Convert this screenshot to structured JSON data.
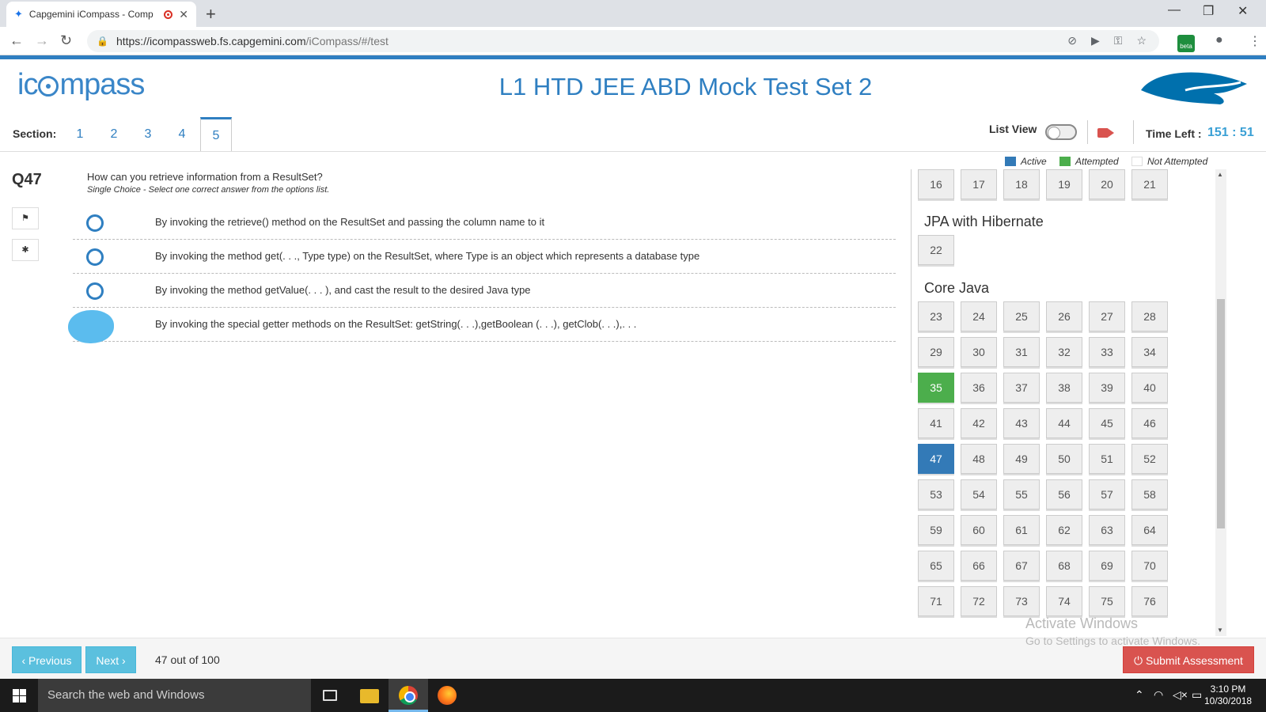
{
  "browser": {
    "tab_title": "Capgemini iCompass - Comp",
    "close_tab": "✕",
    "new_tab": "+",
    "window_controls": [
      "—",
      "❐",
      "✕"
    ],
    "nav": {
      "back": "←",
      "forward": "→",
      "reload": "↻"
    },
    "url_host": "https://icompassweb.fs.capgemini.com",
    "url_path": "/iCompass/#/test",
    "beta_badge": "beta"
  },
  "app": {
    "logo_prefix": "ic",
    "logo_suffix": "mpass",
    "title": "L1 HTD JEE ABD Mock Test Set 2"
  },
  "section_bar": {
    "label": "Section:",
    "sections": [
      "1",
      "2",
      "3",
      "4",
      "5"
    ],
    "active_section": "5",
    "list_view_label": "List View",
    "list_view_on": false,
    "time_left_label": "Time Left :",
    "time_left_value": "151 : 51"
  },
  "question": {
    "number": "Q47",
    "text": "How can you retrieve information from a ResultSet?",
    "hint": "Single Choice - Select one correct answer from the options list.",
    "options": [
      "By invoking the retrieve() method on the ResultSet and passing the column name to it",
      "By invoking the method get(. . ., Type type) on the ResultSet, where Type is an object which represents a database type",
      "By invoking the method getValue(. . . ), and cast the result to the desired Java type",
      "By invoking the special getter methods on the ResultSet: getString(. . .),getBoolean (. . .), getClob(. . .),. . ."
    ]
  },
  "legend": {
    "active": "Active",
    "attempted": "Attempted",
    "not_attempted": "Not Attempted",
    "colors": {
      "active": "#337ab7",
      "attempted": "#4cae4c",
      "not_attempted": "#eeeeee"
    }
  },
  "palette": {
    "row_top": [
      "16",
      "17",
      "18",
      "19",
      "20",
      "21"
    ],
    "group_jpa": "JPA with Hibernate",
    "jpa_items": [
      "22"
    ],
    "group_core_java": "Core Java",
    "rows": [
      [
        "23",
        "24",
        "25",
        "26",
        "27",
        "28"
      ],
      [
        "29",
        "30",
        "31",
        "32",
        "33",
        "34"
      ],
      [
        "35",
        "36",
        "37",
        "38",
        "39",
        "40"
      ],
      [
        "41",
        "42",
        "43",
        "44",
        "45",
        "46"
      ],
      [
        "47",
        "48",
        "49",
        "50",
        "51",
        "52"
      ],
      [
        "53",
        "54",
        "55",
        "56",
        "57",
        "58"
      ],
      [
        "59",
        "60",
        "61",
        "62",
        "63",
        "64"
      ],
      [
        "65",
        "66",
        "67",
        "68",
        "69",
        "70"
      ],
      [
        "71",
        "72",
        "73",
        "74",
        "75",
        "76"
      ]
    ],
    "attempted": [
      "35"
    ],
    "active": "47"
  },
  "footer": {
    "previous": "‹ Previous",
    "next": "Next ›",
    "progress": "47 out of 100",
    "submit": "⏻ Submit Assessment",
    "watermark_title": "Activate Windows",
    "watermark_sub": "Go to Settings to activate Windows."
  },
  "taskbar": {
    "search_placeholder": "Search the web and Windows",
    "time": "3:10 PM",
    "date": "10/30/2018"
  }
}
